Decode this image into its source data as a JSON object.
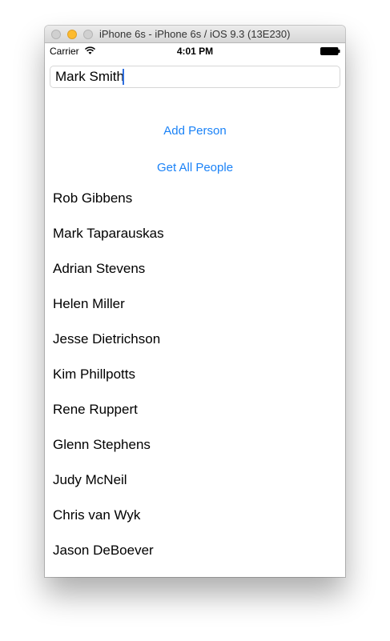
{
  "window": {
    "title": "iPhone 6s - iPhone 6s / iOS 9.3 (13E230)"
  },
  "status_bar": {
    "carrier": "Carrier",
    "time": "4:01 PM",
    "icons": [
      "wifi-icon",
      "battery-icon"
    ]
  },
  "form": {
    "name_value": "Mark Smith",
    "add_person_label": "Add Person",
    "get_all_label": "Get All People"
  },
  "people": [
    "Rob Gibbens",
    "Mark Taparauskas",
    "Adrian Stevens",
    "Helen Miller",
    "Jesse Dietrichson",
    "Kim Phillpotts",
    "Rene Ruppert",
    "Glenn Stephens",
    "Judy McNeil",
    "Chris van Wyk",
    "Jason DeBoever"
  ],
  "colors": {
    "accent": "#1a82f7",
    "caret": "#2f6fe0"
  }
}
